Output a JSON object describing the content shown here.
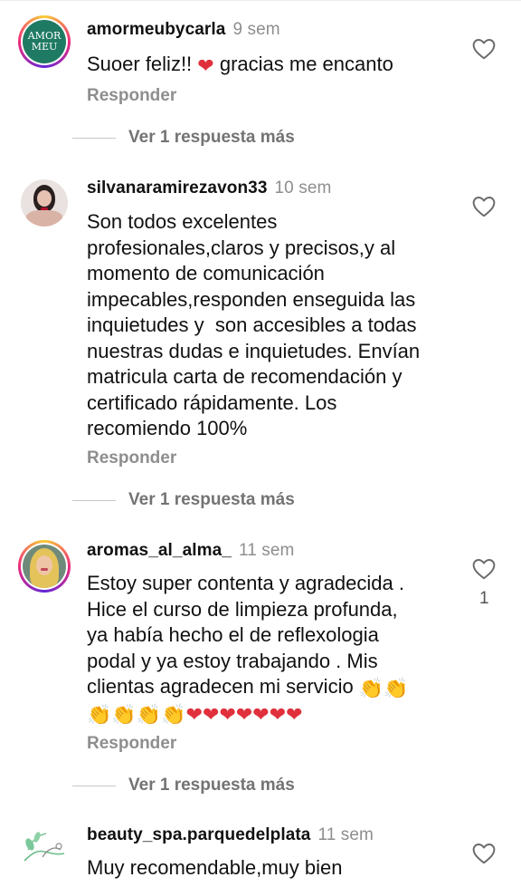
{
  "comments": [
    {
      "username": "amormeubycarla",
      "time": "9 sem",
      "text_before": "Suoer feliz!! ",
      "text_after": " gracias me encanto",
      "avatar_label_top": "AMOR",
      "avatar_label_bottom": "MEU",
      "reply_label": "Responder",
      "more_replies_label": "Ver 1 respuesta más"
    },
    {
      "username": "silvanaramirezavon33",
      "time": "10 sem",
      "text": "Son todos excelentes\nprofesionales,claros y precisos,y al\nmomento de comunicación\nimpecables,responden enseguida las\ninquietudes y  son accesibles a todas\nnuestras dudas e inquietudes. Envían\nmatricula carta de recomendación y\ncertificado rápidamente. Los\nrecomiendo 100%",
      "reply_label": "Responder",
      "more_replies_label": "Ver 1 respuesta más"
    },
    {
      "username": "aromas_al_alma_",
      "time": "11 sem",
      "text": "Estoy super contenta y agradecida .\nHice el curso de limpieza profunda,\nya había hecho el de reflexologia\npodal y ya estoy trabajando . Mis\nclientas agradecen mi servicio ",
      "emoji_line": "👏👏👏👏❤❤❤❤❤❤❤",
      "like_count": "1",
      "reply_label": "Responder",
      "more_replies_label": "Ver 1 respuesta más"
    },
    {
      "username": "beauty_spa.parquedelplata",
      "time": "11 sem",
      "text": "Muy recomendable,muy bien"
    }
  ],
  "colors": {
    "heart_emoji": "#e0303c",
    "muted_text": "#8e8e8e",
    "story_ring": "#ee2a7b"
  },
  "icons": {
    "like": "heart-outline-icon"
  }
}
